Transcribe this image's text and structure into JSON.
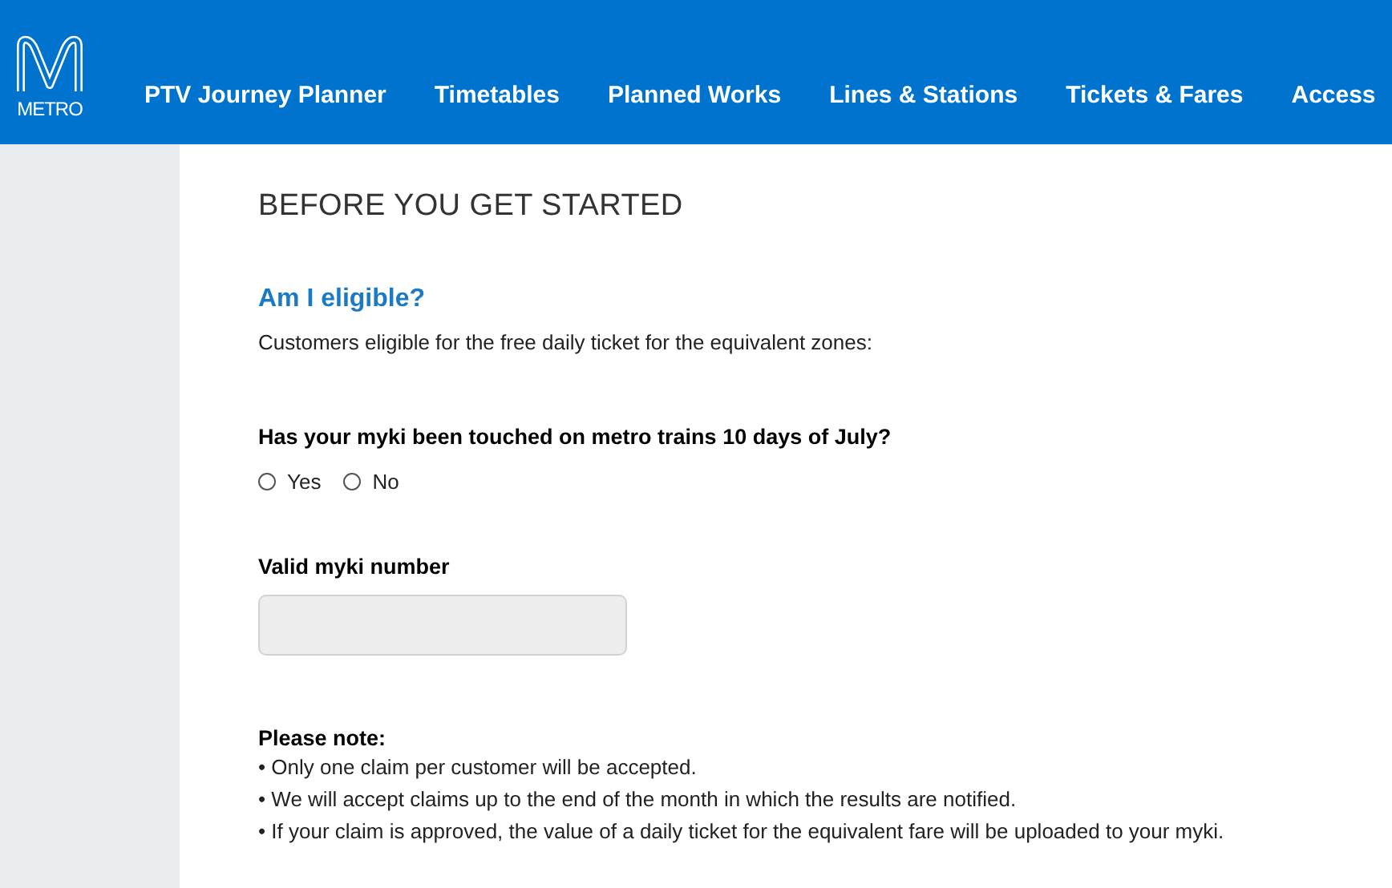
{
  "header": {
    "logo_text": "METRO",
    "nav": [
      {
        "label": "PTV Journey Planner"
      },
      {
        "label": "Timetables"
      },
      {
        "label": "Planned Works"
      },
      {
        "label": "Lines & Stations"
      },
      {
        "label": "Tickets & Fares"
      },
      {
        "label": "Access"
      }
    ]
  },
  "page": {
    "title": "BEFORE YOU GET STARTED",
    "subtitle": "Am I eligible?",
    "intro": "Customers eligible for the free daily ticket for the equivalent zones:",
    "question": {
      "label": "Has your myki been touched on metro trains 10 days of July?",
      "options": [
        {
          "label": "Yes",
          "selected": false
        },
        {
          "label": "No",
          "selected": false
        }
      ]
    },
    "myki_field": {
      "label": "Valid myki number"
    },
    "note": {
      "heading": "Please note:",
      "items": [
        "• Only one claim per customer will be accepted.",
        "• We will accept claims up to the end of the month in which the results are notified.",
        "• If your claim is approved, the value of a daily ticket for the equivalent fare will be uploaded to your myki."
      ]
    }
  }
}
